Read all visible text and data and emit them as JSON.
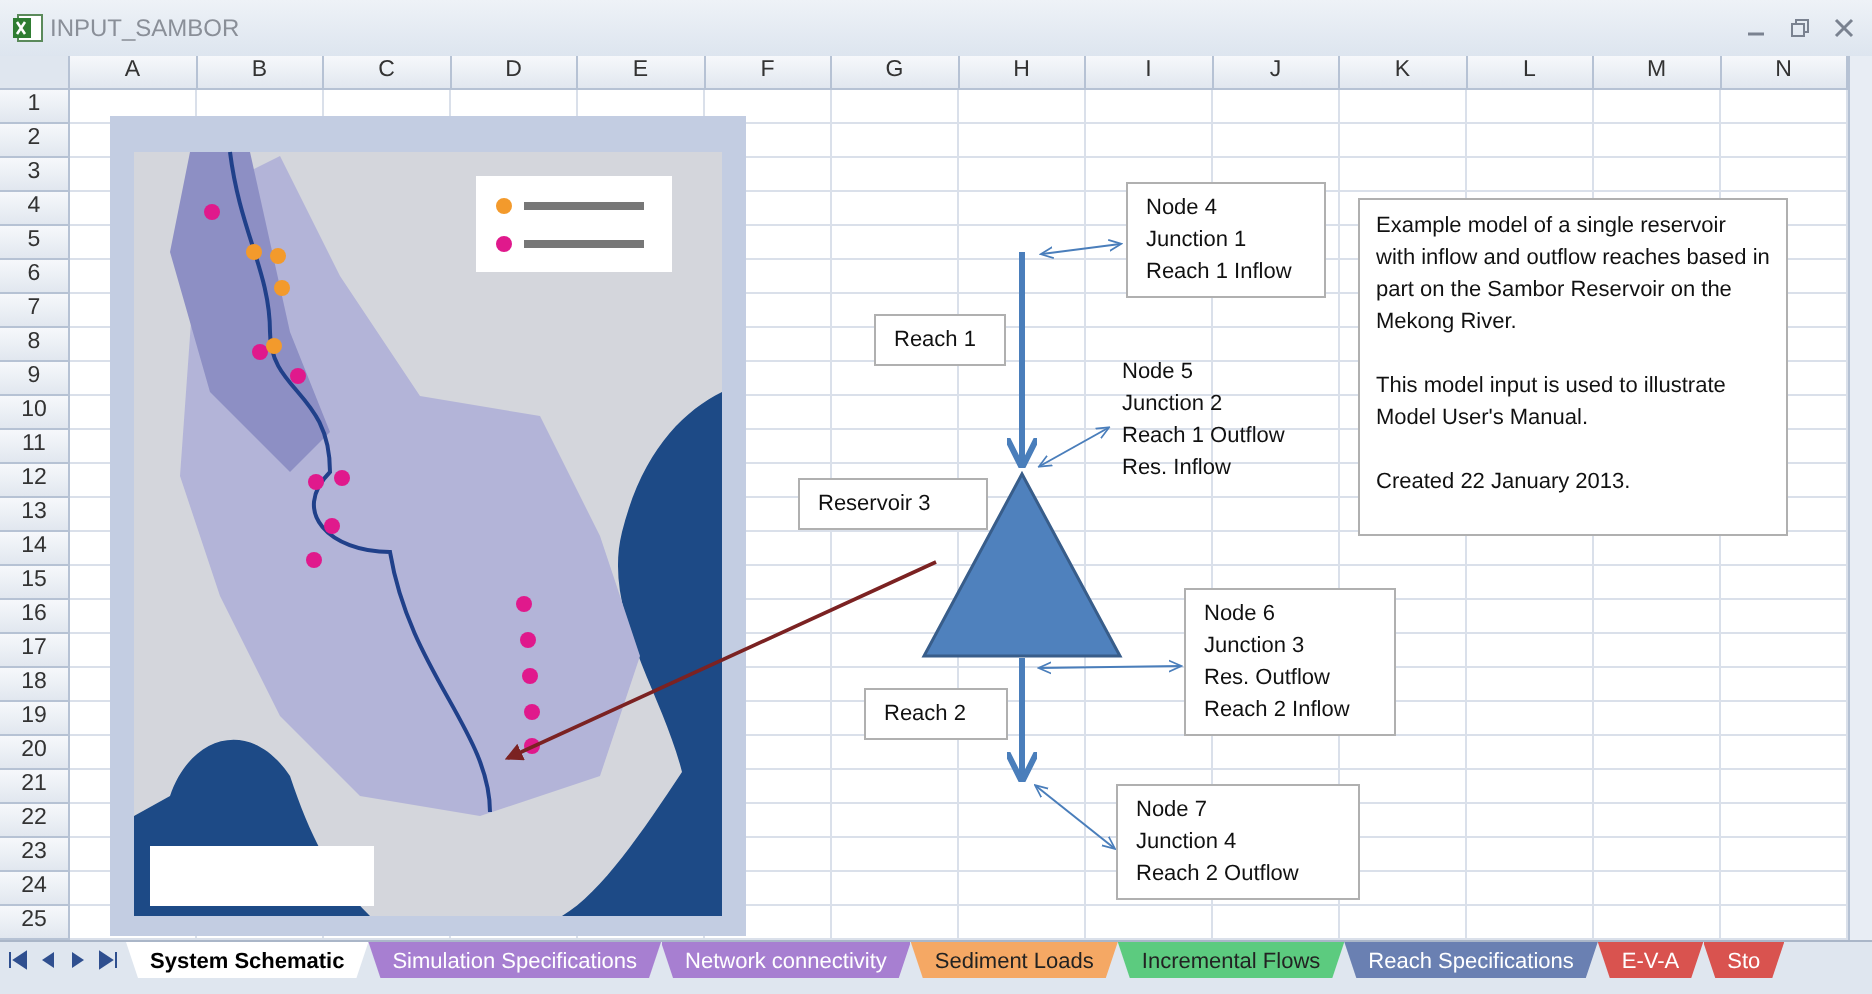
{
  "window": {
    "title": "INPUT_SAMBOR"
  },
  "sheet": {
    "columns": [
      "A",
      "B",
      "C",
      "D",
      "E",
      "F",
      "G",
      "H",
      "I",
      "J",
      "K",
      "L",
      "M",
      "N"
    ],
    "rows": [
      "1",
      "2",
      "3",
      "4",
      "5",
      "6",
      "7",
      "8",
      "9",
      "10",
      "11",
      "12",
      "13",
      "14",
      "15",
      "16",
      "17",
      "18",
      "19",
      "20",
      "21",
      "22",
      "23",
      "24",
      "25"
    ]
  },
  "diagram": {
    "labels": [
      {
        "kind": "box",
        "lines": [
          "Node 4",
          "Junction 1",
          "Reach 1 Inflow"
        ]
      },
      {
        "kind": "box",
        "lines": [
          "Reach 1"
        ]
      },
      {
        "kind": "plain",
        "lines": [
          "Node 5",
          "Junction 2",
          "Reach 1 Outflow",
          "Res. Inflow"
        ]
      },
      {
        "kind": "box",
        "lines": [
          "Reservoir 3"
        ]
      },
      {
        "kind": "box",
        "lines": [
          "Reach 2"
        ]
      },
      {
        "kind": "box",
        "lines": [
          "Node 6",
          "Junction 3",
          "Res. Outflow",
          "Reach 2 Inflow"
        ]
      },
      {
        "kind": "box",
        "lines": [
          "Node 7",
          "Junction 4",
          "Reach 2 Outflow"
        ]
      }
    ],
    "description": [
      "Example model of a single reservoir with inflow and outflow reaches based in part on the Sambor Reservoir on the Mekong River.",
      "This model input is  used to illustrate Model User's Manual.",
      "Created 22 January 2013."
    ]
  },
  "tabs": [
    {
      "label": "System Schematic",
      "selected": true,
      "color": "#ffffff"
    },
    {
      "label": "Simulation Specifications",
      "selected": false,
      "color": "#a77fd1"
    },
    {
      "label": "Network connectivity",
      "selected": false,
      "color": "#a77fd1"
    },
    {
      "label": "Sediment Loads",
      "selected": false,
      "color": "#f5a864"
    },
    {
      "label": "Incremental Flows",
      "selected": false,
      "color": "#5ccb7f"
    },
    {
      "label": "Reach Specifications",
      "selected": false,
      "color": "#6a80b2"
    },
    {
      "label": "E-V-A",
      "selected": false,
      "color": "#d9534f"
    },
    {
      "label": "Sto",
      "selected": false,
      "color": "#d9534f"
    }
  ]
}
